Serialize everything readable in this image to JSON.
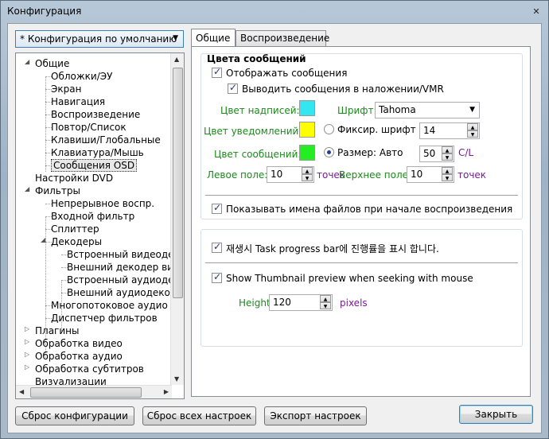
{
  "window": {
    "title": "Конфигурация",
    "close_glyph": "✕"
  },
  "config_selector": {
    "value": "* Конфигурация по умолчанию"
  },
  "tree": {
    "items": [
      {
        "label": "Общие",
        "arrow": "◢"
      },
      {
        "label": "Обложки/ЭУ"
      },
      {
        "label": "Экран"
      },
      {
        "label": "Навигация"
      },
      {
        "label": "Воспроизведение"
      },
      {
        "label": "Повтор/Список"
      },
      {
        "label": "Клавиши/Глобальные"
      },
      {
        "label": "Клавиатура/Мышь"
      },
      {
        "label": "Сообщения OSD",
        "selected": true
      },
      {
        "label": "Настройки DVD"
      },
      {
        "label": "Фильтры",
        "arrow": "◢"
      },
      {
        "label": "Непрерывное воспр."
      },
      {
        "label": "Входной фильтр"
      },
      {
        "label": "Сплиттер"
      },
      {
        "label": "Декодеры",
        "arrow": "◢"
      },
      {
        "label": "Встроенный видеодек"
      },
      {
        "label": "Внешний декодер виде"
      },
      {
        "label": "Встроенный аудиодек"
      },
      {
        "label": "Внешний аудиодекоде"
      },
      {
        "label": "Многопотоковое аудио"
      },
      {
        "label": "Диспетчер фильтров"
      },
      {
        "label": "Плагины",
        "arrow": "▷"
      },
      {
        "label": "Обработка видео",
        "arrow": "▷"
      },
      {
        "label": "Обработка аудио",
        "arrow": "▷"
      },
      {
        "label": "Обработка субтитров",
        "arrow": "▷"
      },
      {
        "label": "Визуализации"
      }
    ]
  },
  "tabs": [
    {
      "label": "Общие",
      "active": true
    },
    {
      "label": "Воспроизведение"
    }
  ],
  "osd": {
    "group_title": "Цвета сообщений",
    "show_messages": "Отображать сообщения",
    "overlay_vmr": "Выводить сообщения в наложении/VMR",
    "caption_color_label": "Цвет надписей:",
    "notify_color_label": "Цвет уведомлений:",
    "message_color_label": "Цвет сообщений:",
    "colors": {
      "caption": "#33e6f0",
      "notify": "#ffff00",
      "message": "#22ee22"
    },
    "font_label": "Шрифт:",
    "font_value": "Tahoma",
    "fixed_font_label": "Фиксир. шрифт",
    "fixed_font_value": "14",
    "size_label": "Размер: Авто",
    "size_value": "50",
    "size_unit": "C/L",
    "left_margin_label": "Левое поле:",
    "left_margin_value": "10",
    "left_margin_unit": "точек",
    "top_margin_label": "Верхнее поле:",
    "top_margin_value": "10",
    "top_margin_unit": "точек",
    "show_filenames": "Показывать имена файлов при начале воспроизведения"
  },
  "progress": {
    "task_progress": "재생시 Task progress bar에 진행률을 표시 합니다.",
    "thumbnail_preview": "Show Thumbnail preview when seeking with mouse",
    "height_label": "Height:",
    "height_value": "120",
    "height_unit": "pixels"
  },
  "buttons": {
    "reset_config": "Сброс конфигурации",
    "reset_all": "Сброс всех настроек",
    "export": "Экспорт настроек",
    "close": "Закрыть"
  }
}
